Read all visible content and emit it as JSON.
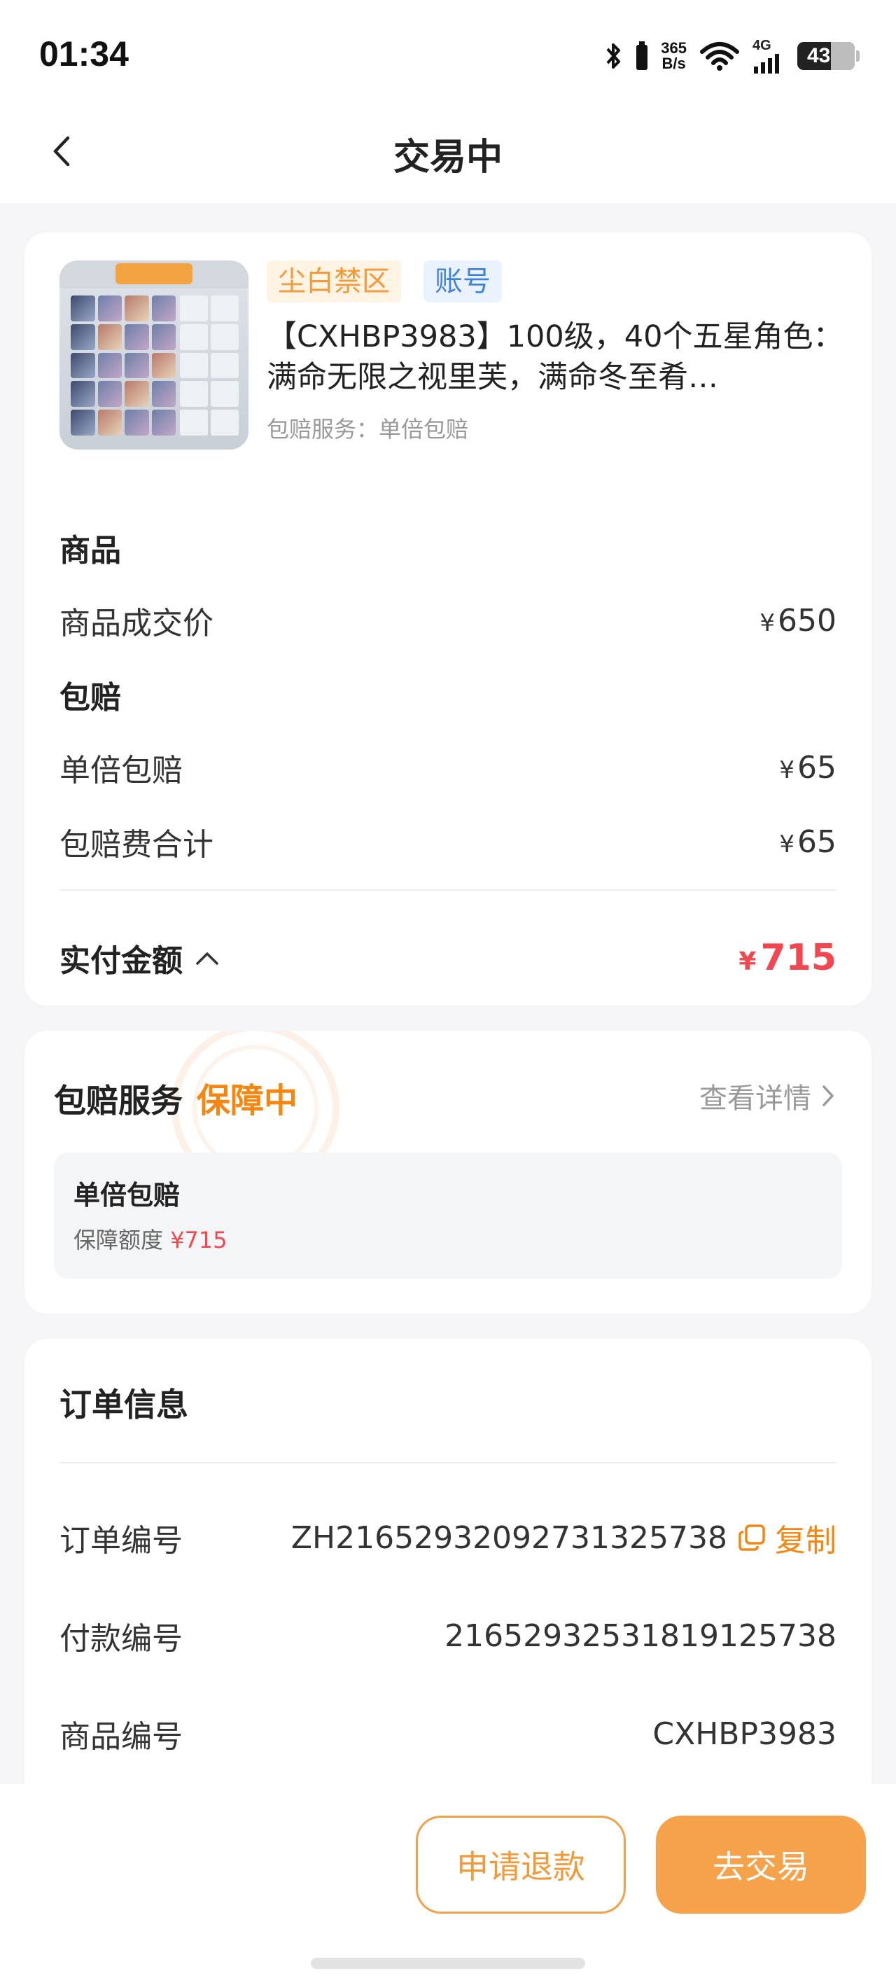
{
  "status_bar": {
    "time": "01:34",
    "net_speed_value": "365",
    "net_speed_unit": "B/s",
    "network_type": "4G",
    "battery_level": "43"
  },
  "nav": {
    "title": "交易中"
  },
  "product": {
    "tag_region": "尘白禁区",
    "tag_type": "账号",
    "title": "【CXHBP3983】100级，40个五星角色：满命无限之视里芙，满命冬至肴…",
    "service": "包赔服务：单倍包赔"
  },
  "price_breakdown": {
    "section_goods": "商品",
    "goods_price_label": "商品成交价",
    "goods_price_currency": "¥",
    "goods_price_value": "650",
    "section_insurance": "包赔",
    "single_insurance_label": "单倍包赔",
    "single_insurance_currency": "¥",
    "single_insurance_value": "65",
    "insurance_total_label": "包赔费合计",
    "insurance_total_currency": "¥",
    "insurance_total_value": "65",
    "paid_label": "实付金额",
    "paid_currency": "¥",
    "paid_value": "715"
  },
  "insurance": {
    "title": "包赔服务",
    "status": "保障中",
    "details_link": "查看详情",
    "plan_name": "单倍包赔",
    "coverage_label": "保障额度",
    "coverage_amount": "¥715"
  },
  "order": {
    "title": "订单信息",
    "order_no_label": "订单编号",
    "order_no_value": "ZH2165293209273132573​8",
    "copy_label": "复制",
    "payment_no_label": "付款编号",
    "payment_no_value": "2165293253181912573​8",
    "goods_no_label": "商品编号",
    "goods_no_value": "CXHBP3983"
  },
  "actions": {
    "refund_label": "申请退款",
    "trade_label": "去交易"
  },
  "colors": {
    "accent_orange": "#f5a24b",
    "price_red": "#f2474f",
    "status_orange": "#f5860f"
  }
}
